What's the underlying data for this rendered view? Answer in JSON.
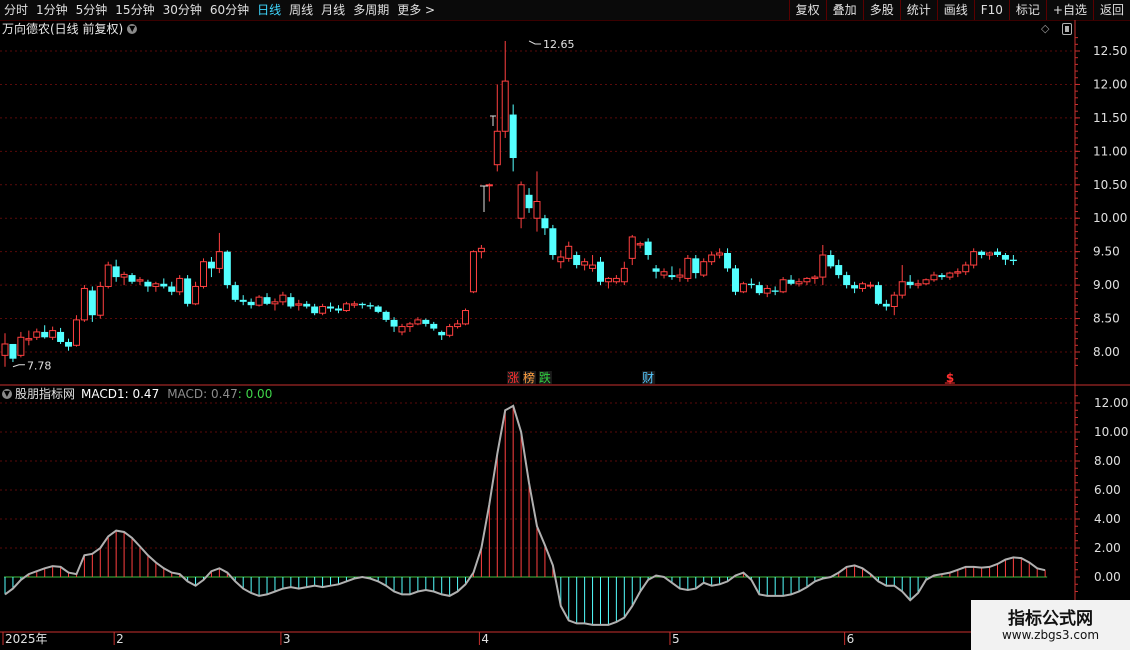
{
  "toolbar": {
    "periods": [
      "分时",
      "1分钟",
      "5分钟",
      "15分钟",
      "30分钟",
      "60分钟",
      "日线",
      "周线",
      "月线",
      "多周期",
      "更多 >"
    ],
    "active_period": 6,
    "tools": [
      "复权",
      "叠加",
      "多股",
      "统计",
      "画线",
      "F10",
      "标记",
      "+自选",
      "返回"
    ]
  },
  "main_panel": {
    "title": "万向德农(日线 前复权)"
  },
  "sub_panel": {
    "title": "股朋指标网",
    "macd1_label": "MACD1: 0.47",
    "macd_label": "MACD: 0.47",
    "macd_extra": ": 0.00"
  },
  "watermark": {
    "name": "指标公式网",
    "url": "www.zbgs3.com"
  },
  "colors": {
    "up": "#ff4040",
    "down": "#54ffff",
    "axis": "#c8302e",
    "grid": "#5a0a0a",
    "macd_line": "#b0b0b0",
    "zero_line": "#40c040"
  },
  "chart_data": [
    {
      "type": "candlestick",
      "ylim": [
        7.6,
        12.8
      ],
      "yticks": [
        "12.50",
        "12.00",
        "11.50",
        "11.00",
        "10.50",
        "10.00",
        "9.50",
        "9.00",
        "8.50",
        "8.00"
      ],
      "ytick_values": [
        12.5,
        12.0,
        11.5,
        11.0,
        10.5,
        10.0,
        9.5,
        9.0,
        8.5,
        8.0
      ],
      "annotations": [
        {
          "text": "12.65",
          "value": 12.65,
          "bar": 66
        },
        {
          "text": "7.78",
          "value": 7.78,
          "bar": 1
        }
      ],
      "event_markers": [
        {
          "bar": 64,
          "text": "涨",
          "color": "#ff3030"
        },
        {
          "bar": 66,
          "text": "榜",
          "color": "#ffa040"
        },
        {
          "bar": 68,
          "text": "跌",
          "color": "#30d040"
        },
        {
          "bar": 81,
          "text": "财",
          "color": "#54c8ff"
        },
        {
          "bar": 119,
          "text": "$",
          "color": "#ff3030"
        }
      ],
      "x_labels": [
        {
          "bar": 0,
          "text": "2025年"
        },
        {
          "bar": 14,
          "text": "2"
        },
        {
          "bar": 35,
          "text": "3"
        },
        {
          "bar": 60,
          "text": "4"
        },
        {
          "bar": 84,
          "text": "5"
        },
        {
          "bar": 106,
          "text": "6"
        }
      ],
      "ohlc": [
        [
          7.95,
          8.28,
          7.78,
          8.12
        ],
        [
          8.12,
          8.05,
          7.85,
          7.9
        ],
        [
          7.95,
          8.3,
          7.92,
          8.22
        ],
        [
          8.18,
          8.32,
          8.1,
          8.2
        ],
        [
          8.22,
          8.35,
          8.18,
          8.3
        ],
        [
          8.3,
          8.4,
          8.2,
          8.22
        ],
        [
          8.22,
          8.38,
          8.18,
          8.32
        ],
        [
          8.3,
          8.36,
          8.12,
          8.15
        ],
        [
          8.15,
          8.2,
          8.02,
          8.08
        ],
        [
          8.1,
          8.55,
          8.08,
          8.48
        ],
        [
          8.48,
          9.0,
          8.45,
          8.95
        ],
        [
          8.92,
          8.98,
          8.45,
          8.55
        ],
        [
          8.55,
          9.05,
          8.5,
          8.98
        ],
        [
          8.98,
          9.35,
          8.95,
          9.3
        ],
        [
          9.28,
          9.38,
          9.05,
          9.12
        ],
        [
          9.12,
          9.2,
          9.0,
          9.16
        ],
        [
          9.15,
          9.18,
          9.02,
          9.05
        ],
        [
          9.06,
          9.12,
          9.0,
          9.08
        ],
        [
          9.05,
          9.08,
          8.9,
          8.98
        ],
        [
          8.98,
          9.05,
          8.9,
          9.02
        ],
        [
          9.02,
          9.1,
          8.95,
          8.98
        ],
        [
          8.98,
          9.05,
          8.85,
          8.9
        ],
        [
          8.9,
          9.15,
          8.85,
          9.1
        ],
        [
          9.1,
          9.15,
          8.68,
          8.72
        ],
        [
          8.72,
          9.05,
          8.7,
          8.98
        ],
        [
          8.98,
          9.4,
          8.95,
          9.35
        ],
        [
          9.35,
          9.42,
          9.12,
          9.25
        ],
        [
          9.25,
          9.78,
          9.18,
          9.5
        ],
        [
          9.5,
          9.52,
          8.95,
          9.0
        ],
        [
          9.0,
          9.05,
          8.75,
          8.78
        ],
        [
          8.78,
          8.85,
          8.7,
          8.75
        ],
        [
          8.75,
          8.8,
          8.65,
          8.7
        ],
        [
          8.7,
          8.85,
          8.68,
          8.82
        ],
        [
          8.82,
          8.88,
          8.7,
          8.72
        ],
        [
          8.72,
          8.8,
          8.62,
          8.75
        ],
        [
          8.75,
          8.9,
          8.7,
          8.85
        ],
        [
          8.82,
          8.88,
          8.65,
          8.68
        ],
        [
          8.7,
          8.78,
          8.62,
          8.72
        ],
        [
          8.72,
          8.76,
          8.65,
          8.68
        ],
        [
          8.68,
          8.72,
          8.55,
          8.58
        ],
        [
          8.58,
          8.72,
          8.55,
          8.68
        ],
        [
          8.68,
          8.74,
          8.6,
          8.65
        ],
        [
          8.65,
          8.7,
          8.58,
          8.62
        ],
        [
          8.62,
          8.75,
          8.6,
          8.72
        ],
        [
          8.7,
          8.76,
          8.66,
          8.72
        ],
        [
          8.72,
          8.74,
          8.65,
          8.7
        ],
        [
          8.7,
          8.74,
          8.64,
          8.68
        ],
        [
          8.68,
          8.7,
          8.58,
          8.6
        ],
        [
          8.6,
          8.62,
          8.45,
          8.48
        ],
        [
          8.48,
          8.52,
          8.3,
          8.38
        ],
        [
          8.3,
          8.42,
          8.25,
          8.38
        ],
        [
          8.38,
          8.45,
          8.3,
          8.42
        ],
        [
          8.42,
          8.52,
          8.4,
          8.48
        ],
        [
          8.48,
          8.5,
          8.38,
          8.42
        ],
        [
          8.42,
          8.45,
          8.32,
          8.35
        ],
        [
          8.3,
          8.32,
          8.18,
          8.25
        ],
        [
          8.25,
          8.42,
          8.22,
          8.38
        ],
        [
          8.38,
          8.48,
          8.35,
          8.42
        ],
        [
          8.42,
          8.65,
          8.4,
          8.62
        ],
        [
          8.9,
          9.52,
          8.88,
          9.5
        ],
        [
          9.5,
          9.6,
          9.4,
          9.55
        ],
        [
          10.5,
          10.52,
          10.25,
          10.5
        ],
        [
          10.8,
          12.0,
          10.7,
          11.3
        ],
        [
          11.3,
          12.65,
          11.2,
          12.05
        ],
        [
          11.55,
          11.7,
          10.7,
          10.9
        ],
        [
          10.0,
          10.55,
          9.85,
          10.5
        ],
        [
          10.35,
          10.45,
          10.08,
          10.15
        ],
        [
          10.0,
          10.7,
          9.8,
          10.25
        ],
        [
          10.0,
          10.05,
          9.75,
          9.85
        ],
        [
          9.85,
          9.9,
          9.38,
          9.45
        ],
        [
          9.35,
          9.52,
          9.25,
          9.42
        ],
        [
          9.4,
          9.65,
          9.35,
          9.58
        ],
        [
          9.45,
          9.5,
          9.25,
          9.3
        ],
        [
          9.3,
          9.4,
          9.22,
          9.35
        ],
        [
          9.25,
          9.45,
          9.2,
          9.3
        ],
        [
          9.35,
          9.42,
          9.0,
          9.05
        ],
        [
          9.05,
          9.12,
          8.95,
          9.1
        ],
        [
          9.05,
          9.15,
          9.02,
          9.1
        ],
        [
          9.05,
          9.35,
          9.0,
          9.25
        ],
        [
          9.4,
          9.75,
          9.3,
          9.72
        ],
        [
          9.6,
          9.65,
          9.55,
          9.62
        ],
        [
          9.65,
          9.7,
          9.38,
          9.45
        ],
        [
          9.25,
          9.3,
          9.1,
          9.2
        ],
        [
          9.15,
          9.25,
          9.1,
          9.2
        ],
        [
          9.15,
          9.28,
          9.08,
          9.12
        ],
        [
          9.12,
          9.25,
          9.05,
          9.15
        ],
        [
          9.1,
          9.45,
          9.05,
          9.4
        ],
        [
          9.4,
          9.45,
          9.1,
          9.18
        ],
        [
          9.15,
          9.4,
          9.12,
          9.35
        ],
        [
          9.35,
          9.5,
          9.3,
          9.45
        ],
        [
          9.45,
          9.55,
          9.4,
          9.48
        ],
        [
          9.48,
          9.55,
          9.2,
          9.25
        ],
        [
          9.25,
          9.3,
          8.85,
          8.9
        ],
        [
          8.9,
          9.05,
          8.88,
          9.02
        ],
        [
          9.02,
          9.1,
          8.95,
          9.0
        ],
        [
          9.0,
          9.05,
          8.85,
          8.88
        ],
        [
          8.88,
          9.0,
          8.82,
          8.95
        ],
        [
          8.92,
          8.98,
          8.85,
          8.9
        ],
        [
          8.9,
          9.12,
          8.88,
          9.08
        ],
        [
          9.08,
          9.15,
          9.0,
          9.02
        ],
        [
          9.02,
          9.1,
          8.98,
          9.05
        ],
        [
          9.05,
          9.12,
          9.0,
          9.1
        ],
        [
          9.1,
          9.15,
          9.02,
          9.12
        ],
        [
          9.12,
          9.6,
          9.0,
          9.45
        ],
        [
          9.45,
          9.52,
          9.25,
          9.28
        ],
        [
          9.3,
          9.38,
          9.1,
          9.15
        ],
        [
          9.15,
          9.2,
          8.95,
          9.0
        ],
        [
          9.0,
          9.05,
          8.88,
          8.95
        ],
        [
          8.95,
          9.05,
          8.9,
          9.02
        ],
        [
          9.0,
          9.05,
          8.95,
          9.0
        ],
        [
          9.0,
          9.05,
          8.7,
          8.72
        ],
        [
          8.72,
          8.78,
          8.62,
          8.68
        ],
        [
          8.68,
          8.9,
          8.55,
          8.85
        ],
        [
          8.85,
          9.3,
          8.8,
          9.05
        ],
        [
          9.05,
          9.15,
          8.95,
          9.0
        ],
        [
          9.0,
          9.08,
          8.95,
          9.02
        ],
        [
          9.02,
          9.1,
          9.0,
          9.08
        ],
        [
          9.08,
          9.2,
          9.05,
          9.15
        ],
        [
          9.15,
          9.18,
          9.08,
          9.12
        ],
        [
          9.12,
          9.2,
          9.08,
          9.18
        ],
        [
          9.18,
          9.25,
          9.12,
          9.2
        ],
        [
          9.2,
          9.35,
          9.15,
          9.3
        ],
        [
          9.3,
          9.55,
          9.25,
          9.5
        ],
        [
          9.5,
          9.52,
          9.4,
          9.45
        ],
        [
          9.45,
          9.5,
          9.38,
          9.48
        ],
        [
          9.5,
          9.55,
          9.42,
          9.45
        ],
        [
          9.45,
          9.48,
          9.3,
          9.38
        ],
        [
          9.38,
          9.45,
          9.3,
          9.36
        ]
      ]
    },
    {
      "type": "bar",
      "name": "MACD1",
      "ylim": [
        -1.6,
        12.6
      ],
      "yticks": [
        "12.00",
        "10.00",
        "8.00",
        "6.00",
        "4.00",
        "2.00",
        "0.00"
      ],
      "ytick_values": [
        12,
        10,
        8,
        6,
        4,
        2,
        0
      ],
      "values": [
        -1.2,
        -0.8,
        -0.2,
        0.2,
        0.4,
        0.6,
        0.75,
        0.7,
        0.3,
        0.2,
        1.5,
        1.6,
        2.0,
        2.8,
        3.2,
        3.1,
        2.7,
        2.1,
        1.5,
        1.0,
        0.6,
        0.3,
        0.2,
        -0.3,
        -0.6,
        -0.2,
        0.4,
        0.6,
        0.3,
        -0.3,
        -0.8,
        -1.1,
        -1.3,
        -1.2,
        -1.0,
        -0.8,
        -0.7,
        -0.8,
        -0.7,
        -0.6,
        -0.7,
        -0.6,
        -0.5,
        -0.3,
        -0.1,
        0.0,
        -0.1,
        -0.3,
        -0.6,
        -1.0,
        -1.2,
        -1.2,
        -1.0,
        -0.9,
        -1.0,
        -1.2,
        -1.3,
        -1.0,
        -0.5,
        0.3,
        2.0,
        5.0,
        8.5,
        11.5,
        11.8,
        10.0,
        6.5,
        3.5,
        2.2,
        0.8,
        -2.0,
        -3.0,
        -3.2,
        -3.2,
        -3.3,
        -3.3,
        -3.3,
        -3.1,
        -2.8,
        -2.0,
        -1.0,
        -0.2,
        0.1,
        0.0,
        -0.4,
        -0.8,
        -0.9,
        -0.8,
        -0.4,
        -0.6,
        -0.5,
        -0.3,
        0.1,
        0.3,
        -0.2,
        -1.2,
        -1.3,
        -1.3,
        -1.3,
        -1.2,
        -1.0,
        -0.7,
        -0.3,
        -0.1,
        0.0,
        0.3,
        0.7,
        0.8,
        0.6,
        0.2,
        -0.3,
        -0.6,
        -0.6,
        -1.0,
        -1.6,
        -1.1,
        -0.2,
        0.1,
        0.2,
        0.3,
        0.5,
        0.7,
        0.7,
        0.65,
        0.7,
        0.9,
        1.2,
        1.35,
        1.3,
        1.0,
        0.6,
        0.47
      ]
    }
  ]
}
